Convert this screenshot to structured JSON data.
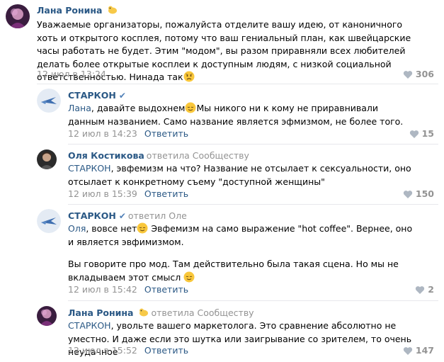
{
  "comments": [
    {
      "author": "Лана Ронина",
      "text": "Уважаемые организаторы, пожалуйста отделите вашу идею, от каноничного хоть и открытого косплея, потому что ваш гениальный план, как швейцарские часы работать не будет. Этим \"модом\", вы разом приравняли всех любителей делать более открытые косплеи к доступным людям, с низкой социальной ответственностью. Нинада так",
      "date": "12 июл в 13:24",
      "likes": "306",
      "emoji": "sad-face-emoji"
    },
    {
      "author": "СТАРКОН",
      "mention": "Лана",
      "text_a": ", давайте выдохнем",
      "text_b": "Мы никого ни к кому не приравнивали данным названием. Само название является эфмизмом, не более того.",
      "date": "12 июл в 14:23",
      "reply_label": "Ответить",
      "likes": "15"
    },
    {
      "author": "Оля Костикова",
      "replied_label": "ответила Сообществу",
      "mention": "СТАРКОН",
      "text": ", эвфемизм на что? Название не отсылает к сексуальности, оно отсылает к конкретному съему \"доступной женщины\"",
      "date": "12 июл в 15:39",
      "reply_label": "Ответить",
      "likes": "150"
    },
    {
      "author": "СТАРКОН",
      "replied_label": "ответил",
      "reply_to": "Оле",
      "mention": "Оля",
      "text_a": ", вовсе нет",
      "text_b": " Эвфемизм на само выражение \"hot coffee\". Вернее, оно и является эвфимизмом.",
      "text_c": "Вы говорите про мод. Там действительно была такая сцена. Но мы не вкладываем этот смысл ",
      "date": "12 июл в 15:42",
      "reply_label": "Ответить",
      "likes": "2"
    },
    {
      "author": "Лана Ронина",
      "replied_label": "ответила Сообществу",
      "mention": "СТАРКОН",
      "text": ", увольте вашего маркетолога. Это сравнение абсолютно не уместно. И даже если это шутка или заигрывание со зрителем, то очень неудачное",
      "date": "12 июл в 15:52",
      "reply_label": "Ответить",
      "likes": "147"
    }
  ],
  "colors": {
    "link": "#2a5885",
    "muted": "#939393",
    "accent": "#5181b8",
    "divider": "#e7e8ec"
  }
}
